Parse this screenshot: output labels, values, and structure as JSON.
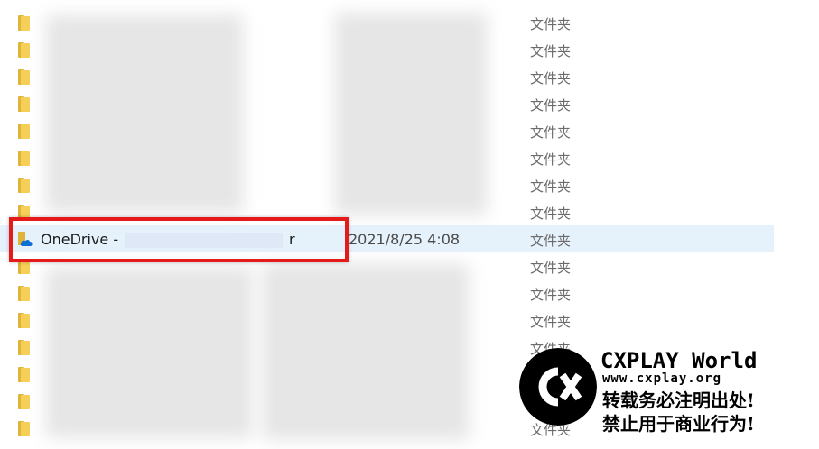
{
  "rows": [
    {
      "type": "文件夹"
    },
    {
      "type": "文件夹"
    },
    {
      "type": "文件夹"
    },
    {
      "type": "文件夹"
    },
    {
      "type": "文件夹"
    },
    {
      "type": "文件夹"
    },
    {
      "type": "文件夹"
    },
    {
      "type": "文件夹"
    },
    {
      "type": "文件夹",
      "name_prefix": "OneDrive -",
      "name_suffix": "r",
      "date": "2021/8/25 4:08",
      "selected": true
    },
    {
      "type": "文件夹"
    },
    {
      "type": "文件夹"
    },
    {
      "type": "文件夹"
    },
    {
      "type": "文件夹"
    },
    {
      "type": "文件夹"
    },
    {
      "type": "文件夹"
    },
    {
      "type": "文件夹"
    }
  ],
  "colors": {
    "highlight_border": "#e51b1b",
    "selection_bg": "#e5f1fb",
    "folder_yellow": "#f6cf58"
  },
  "watermark": {
    "title": "CXPLAY World",
    "url": "www.cxplay.org",
    "line1": "转载务必注明出处!",
    "line2": "禁止用于商业行为!"
  }
}
